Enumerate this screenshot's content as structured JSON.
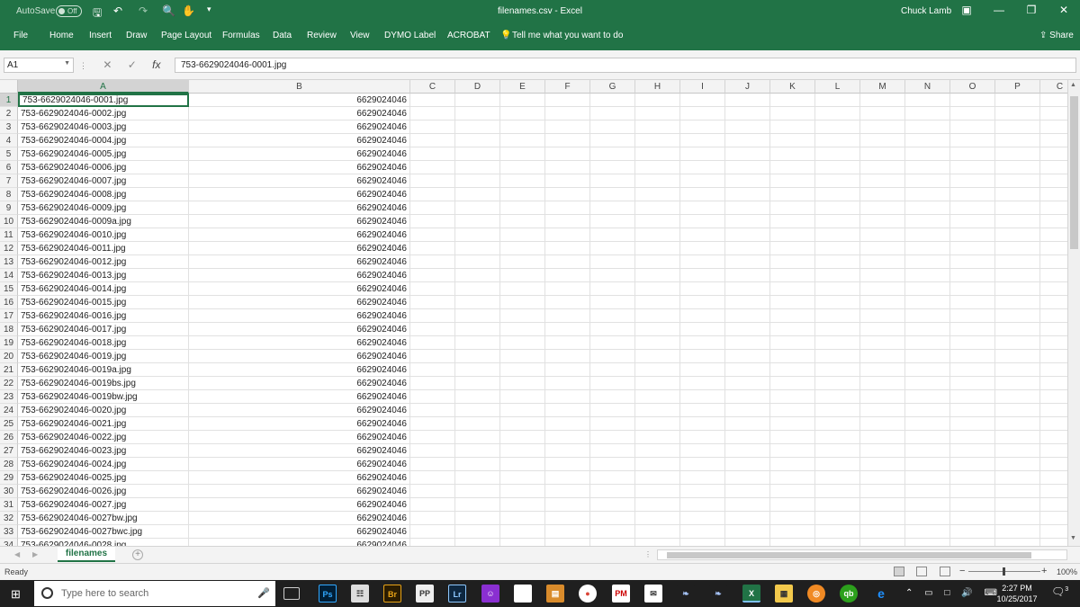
{
  "titlebar": {
    "autosave_label": "AutoSave",
    "autosave_state": "Off",
    "doc_title": "filenames.csv  -  Excel",
    "user": "Chuck Lamb"
  },
  "ribbon": {
    "tabs": [
      "File",
      "Home",
      "Insert",
      "Draw",
      "Page Layout",
      "Formulas",
      "Data",
      "Review",
      "View",
      "DYMO Label",
      "ACROBAT"
    ],
    "tell_me": "Tell me what you want to do",
    "share": "Share"
  },
  "formula_bar": {
    "name_box": "A1",
    "formula": "753-6629024046-0001.jpg"
  },
  "sheet": {
    "columns": [
      "A",
      "B",
      "C",
      "D",
      "E",
      "F",
      "G",
      "H",
      "I",
      "J",
      "K",
      "L",
      "M",
      "N",
      "O",
      "P",
      "C"
    ],
    "rows": [
      {
        "n": "1",
        "a": "753-6629024046-0001.jpg",
        "b": "6629024046"
      },
      {
        "n": "2",
        "a": "753-6629024046-0002.jpg",
        "b": "6629024046"
      },
      {
        "n": "3",
        "a": "753-6629024046-0003.jpg",
        "b": "6629024046"
      },
      {
        "n": "4",
        "a": "753-6629024046-0004.jpg",
        "b": "6629024046"
      },
      {
        "n": "5",
        "a": "753-6629024046-0005.jpg",
        "b": "6629024046"
      },
      {
        "n": "6",
        "a": "753-6629024046-0006.jpg",
        "b": "6629024046"
      },
      {
        "n": "7",
        "a": "753-6629024046-0007.jpg",
        "b": "6629024046"
      },
      {
        "n": "8",
        "a": "753-6629024046-0008.jpg",
        "b": "6629024046"
      },
      {
        "n": "9",
        "a": "753-6629024046-0009.jpg",
        "b": "6629024046"
      },
      {
        "n": "10",
        "a": "753-6629024046-0009a.jpg",
        "b": "6629024046"
      },
      {
        "n": "11",
        "a": "753-6629024046-0010.jpg",
        "b": "6629024046"
      },
      {
        "n": "12",
        "a": "753-6629024046-0011.jpg",
        "b": "6629024046"
      },
      {
        "n": "13",
        "a": "753-6629024046-0012.jpg",
        "b": "6629024046"
      },
      {
        "n": "14",
        "a": "753-6629024046-0013.jpg",
        "b": "6629024046"
      },
      {
        "n": "15",
        "a": "753-6629024046-0014.jpg",
        "b": "6629024046"
      },
      {
        "n": "16",
        "a": "753-6629024046-0015.jpg",
        "b": "6629024046"
      },
      {
        "n": "17",
        "a": "753-6629024046-0016.jpg",
        "b": "6629024046"
      },
      {
        "n": "18",
        "a": "753-6629024046-0017.jpg",
        "b": "6629024046"
      },
      {
        "n": "19",
        "a": "753-6629024046-0018.jpg",
        "b": "6629024046"
      },
      {
        "n": "20",
        "a": "753-6629024046-0019.jpg",
        "b": "6629024046"
      },
      {
        "n": "21",
        "a": "753-6629024046-0019a.jpg",
        "b": "6629024046"
      },
      {
        "n": "22",
        "a": "753-6629024046-0019bs.jpg",
        "b": "6629024046"
      },
      {
        "n": "23",
        "a": "753-6629024046-0019bw.jpg",
        "b": "6629024046"
      },
      {
        "n": "24",
        "a": "753-6629024046-0020.jpg",
        "b": "6629024046"
      },
      {
        "n": "25",
        "a": "753-6629024046-0021.jpg",
        "b": "6629024046"
      },
      {
        "n": "26",
        "a": "753-6629024046-0022.jpg",
        "b": "6629024046"
      },
      {
        "n": "27",
        "a": "753-6629024046-0023.jpg",
        "b": "6629024046"
      },
      {
        "n": "28",
        "a": "753-6629024046-0024.jpg",
        "b": "6629024046"
      },
      {
        "n": "29",
        "a": "753-6629024046-0025.jpg",
        "b": "6629024046"
      },
      {
        "n": "30",
        "a": "753-6629024046-0026.jpg",
        "b": "6629024046"
      },
      {
        "n": "31",
        "a": "753-6629024046-0027.jpg",
        "b": "6629024046"
      },
      {
        "n": "32",
        "a": "753-6629024046-0027bw.jpg",
        "b": "6629024046"
      },
      {
        "n": "33",
        "a": "753-6629024046-0027bwc.jpg",
        "b": "6629024046"
      },
      {
        "n": "34",
        "a": "753-6629024046-0028.jpg",
        "b": "6629024046"
      }
    ],
    "tab_name": "filenames"
  },
  "status": {
    "ready": "Ready",
    "zoom": "100%"
  },
  "taskbar": {
    "search_placeholder": "Type here to search",
    "time": "2:27 PM",
    "date": "10/25/2017",
    "notification_count": "3"
  },
  "colors": {
    "excel_green": "#217346",
    "taskbar": "#1f1f1f"
  }
}
